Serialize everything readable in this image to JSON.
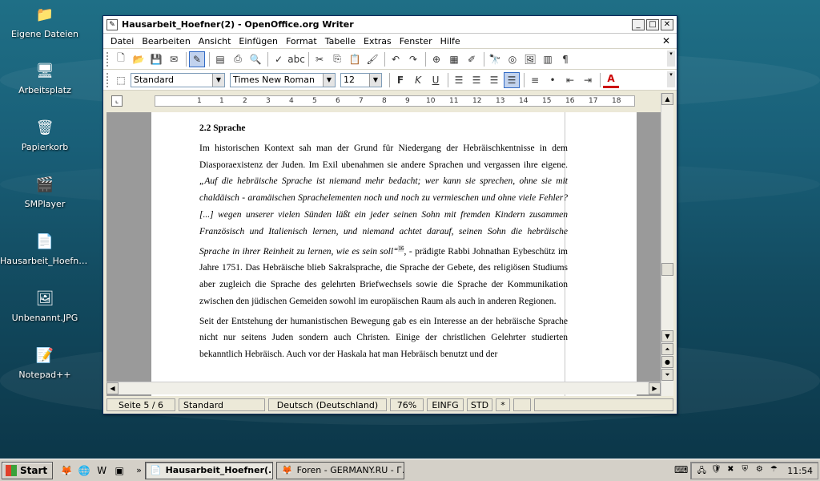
{
  "desktop": {
    "icons": [
      {
        "label": "Eigene Dateien",
        "icon": "folder-icon"
      },
      {
        "label": "Arbeitsplatz",
        "icon": "computer-icon"
      },
      {
        "label": "Papierkorb",
        "icon": "recycle-bin-icon"
      },
      {
        "label": "SMPlayer",
        "icon": "media-player-icon"
      },
      {
        "label": "Hausarbeit_Hoefne...",
        "icon": "document-icon"
      },
      {
        "label": "Unbenannt.JPG",
        "icon": "image-icon"
      },
      {
        "label": "Notepad++",
        "icon": "notepad-icon"
      }
    ]
  },
  "window": {
    "title": "Hausarbeit_Hoefner(2) - OpenOffice.org Writer",
    "menu": [
      "Datei",
      "Bearbeiten",
      "Ansicht",
      "Einfügen",
      "Format",
      "Tabelle",
      "Extras",
      "Fenster",
      "Hilfe"
    ],
    "format_toolbar": {
      "style": "Standard",
      "font": "Times New Roman",
      "size": "12"
    },
    "ruler_numbers": [
      "1",
      "1",
      "2",
      "3",
      "4",
      "5",
      "6",
      "7",
      "8",
      "9",
      "10",
      "11",
      "12",
      "13",
      "14",
      "15",
      "16",
      "17",
      "18"
    ]
  },
  "document": {
    "heading": "2.2 Sprache",
    "para1_a": "Im historischen Kontext sah man der Grund für Niedergang der Hebräischkentnisse in dem Diasporaexistenz der Juden. Im Exil ubenahmen sie andere Sprachen und vergassen ihre eigene. ",
    "para1_quote": "„Auf die hebräische Sprache ist niemand mehr bedacht; wer kann sie sprechen, ohne sie mit chaldäisch - aramäischen Sprachelementen noch und noch zu vermieschen und ohne viele Fehler? [...] wegen unserer vielen Sünden läßt ein jeder seinen Sohn mit fremden Kindern zusammen Französisch und Italienisch lernen, und niemand achtet darauf, seinen Sohn die hebräische Sprache in ihrer Reinheit zu lernen, wie es sein soll“",
    "para1_footnote": "16",
    "para1_b": ", - prädigte Rabbi Johnathan Eybeschütz im Jahre 1751. Das Hebräische blieb Sakralsprache, die Sprache der Gebete, des religiösen Studiums aber zugleich die Sprache des gelehrten Briefwechsels sowie die Sprache der Kommunikation zwischen den jüdischen Gemeiden sowohl im europäischen Raum als auch in anderen Regionen.",
    "para2": "Seit der Entstehung der humanistischen Bewegung gab es ein Interesse an der hebräische Sprache nicht nur seitens Juden sondern auch Christen. Einige der christlichen Gelehrter studierten bekanntlich Hebräisch. Auch vor der Haskala hat man Hebräisch benutzt und der"
  },
  "statusbar": {
    "page": "Seite 5 / 6",
    "style": "Standard",
    "language": "Deutsch (Deutschland)",
    "zoom": "76%",
    "insert_mode": "EINFG",
    "selection_mode": "STD",
    "modified": "*"
  },
  "taskbar": {
    "start": "Start",
    "tasks": [
      {
        "label": "Hausarbeit_Hoefner(...",
        "active": true
      },
      {
        "label": "Foren - GERMANY.RU - Г...",
        "active": false
      }
    ],
    "clock": "11:54"
  }
}
